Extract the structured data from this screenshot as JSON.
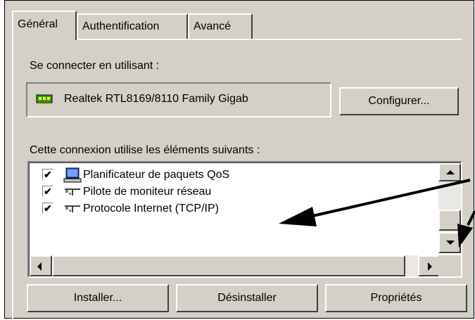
{
  "tabs": [
    {
      "label": "Général",
      "active": true
    },
    {
      "label": "Authentification",
      "active": false
    },
    {
      "label": "Avancé",
      "active": false
    }
  ],
  "connect_label": "Se connecter en utilisant :",
  "adapter": {
    "name": "Realtek RTL8169/8110 Family Gigab",
    "icon": "network-card-icon"
  },
  "configure_button": "Configurer...",
  "components_label": "Cette connexion utilise les éléments suivants :",
  "components": [
    {
      "label": "Planificateur de paquets QoS",
      "checked": true,
      "icon": "computer-icon"
    },
    {
      "label": "Pilote de moniteur réseau",
      "checked": true,
      "icon": "network-protocol-icon"
    },
    {
      "label": "Protocole Internet (TCP/IP)",
      "checked": true,
      "icon": "network-protocol-icon"
    }
  ],
  "buttons": {
    "install": "Installer...",
    "uninstall": "Désinstaller",
    "properties": "Propriétés"
  },
  "colors": {
    "dialog_bg": "#d4d0c8",
    "adapter_icon": "#2e9a2e",
    "arrows": "#000000"
  }
}
